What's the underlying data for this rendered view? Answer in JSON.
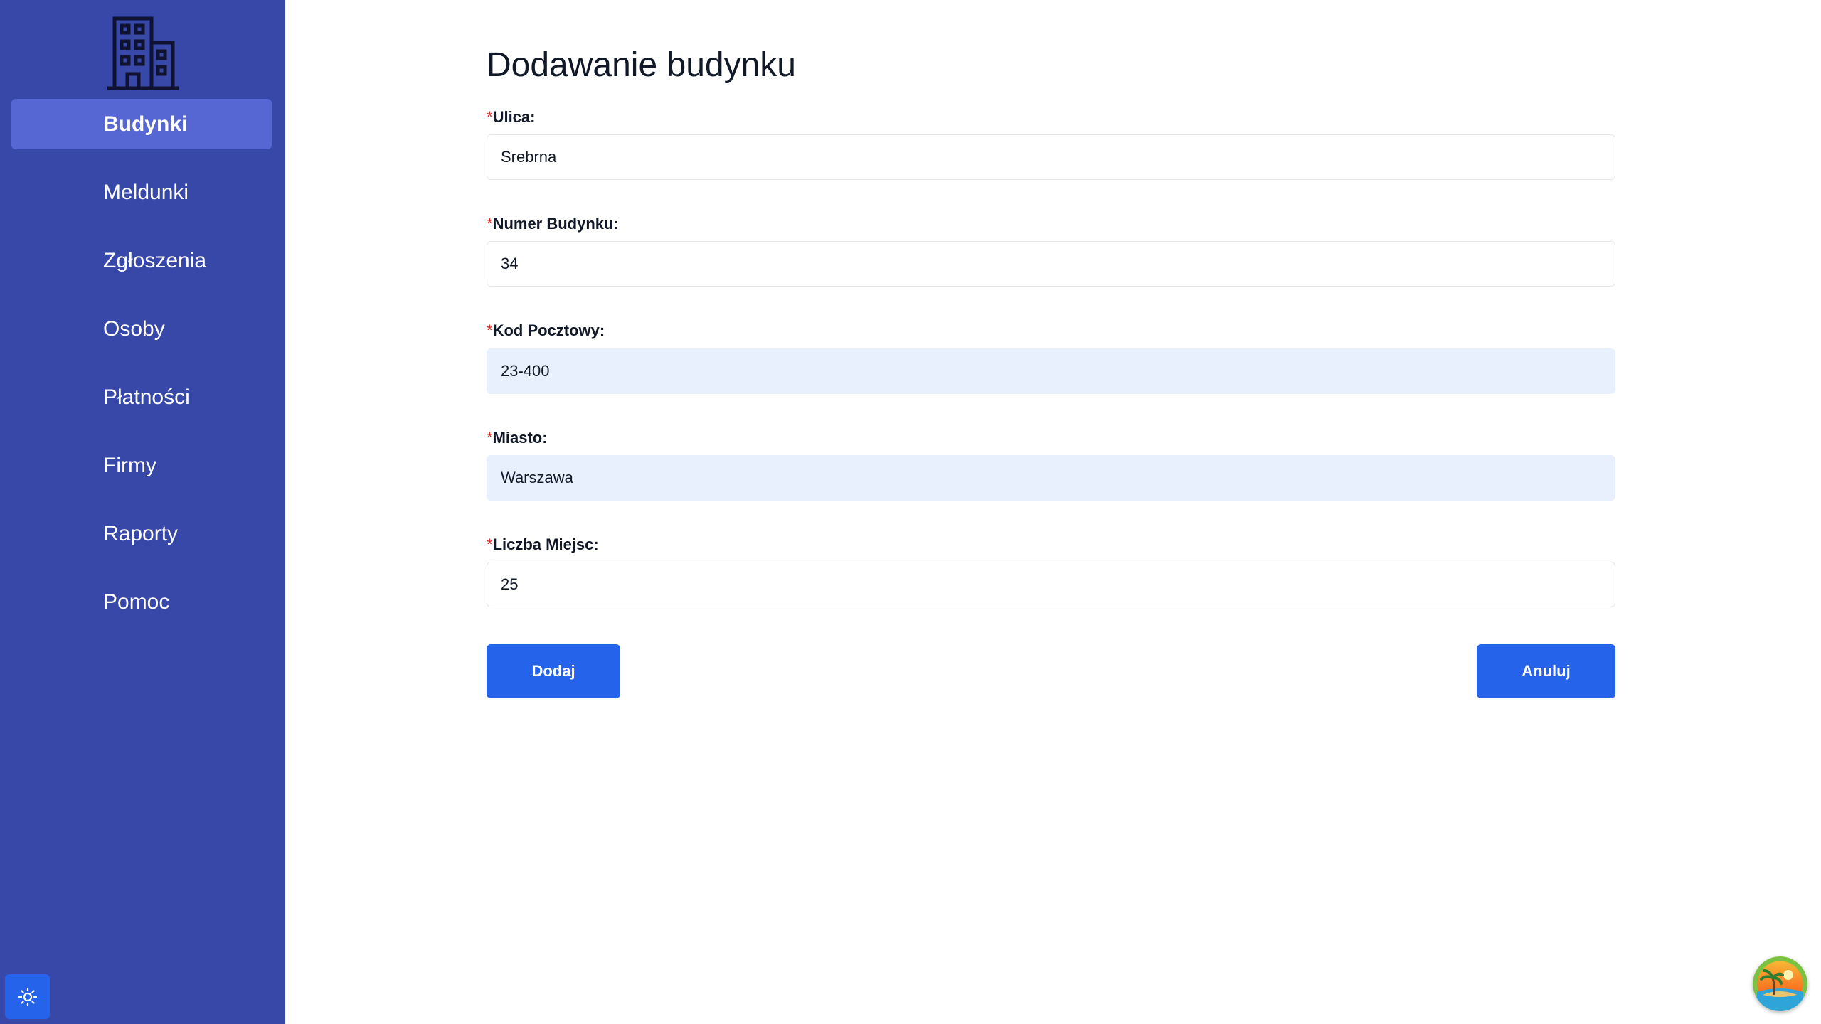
{
  "sidebar": {
    "items": [
      {
        "label": "Budynki",
        "active": true
      },
      {
        "label": "Meldunki"
      },
      {
        "label": "Zgłoszenia"
      },
      {
        "label": "Osoby"
      },
      {
        "label": "Płatności"
      },
      {
        "label": "Firmy"
      },
      {
        "label": "Raporty"
      },
      {
        "label": "Pomoc"
      }
    ],
    "logo_icon": "building-icon",
    "theme_icon": "sun-icon"
  },
  "form": {
    "title": "Dodawanie budynku",
    "required_mark": "*",
    "fields": [
      {
        "label": "Ulica:",
        "value": "Srebrna"
      },
      {
        "label": "Numer Budynku:",
        "value": "34"
      },
      {
        "label": "Kod Pocztowy:",
        "value": "23-400"
      },
      {
        "label": "Miasto:",
        "value": "Warszawa"
      },
      {
        "label": "Liczba Miejsc:",
        "value": "25"
      }
    ],
    "add_label": "Dodaj",
    "cancel_label": "Anuluj"
  },
  "colors": {
    "sidebar_bg": "#3748a8",
    "sidebar_active": "#5667d3",
    "primary": "#2563eb",
    "required": "#dc2626"
  }
}
